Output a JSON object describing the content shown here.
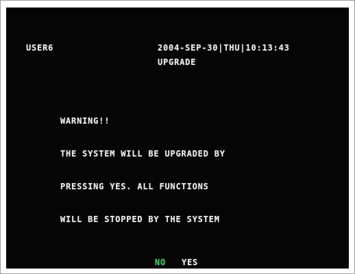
{
  "header": {
    "user": "USER6",
    "date": "2004-SEP-30",
    "weekday": "THU",
    "time": "10:13:43"
  },
  "title": "UPGRADE",
  "message": {
    "lines": [
      "WARNING!!",
      "THE SYSTEM WILL BE UPGRADED BY",
      "PRESSING YES. ALL FUNCTIONS",
      "WILL BE STOPPED BY THE SYSTEM"
    ]
  },
  "buttons": {
    "no_label": "NO",
    "yes_label": "YES",
    "selected": "NO"
  },
  "colors": {
    "background": "#050505",
    "text": "#ececec",
    "selected_button": "#2ecf52"
  }
}
